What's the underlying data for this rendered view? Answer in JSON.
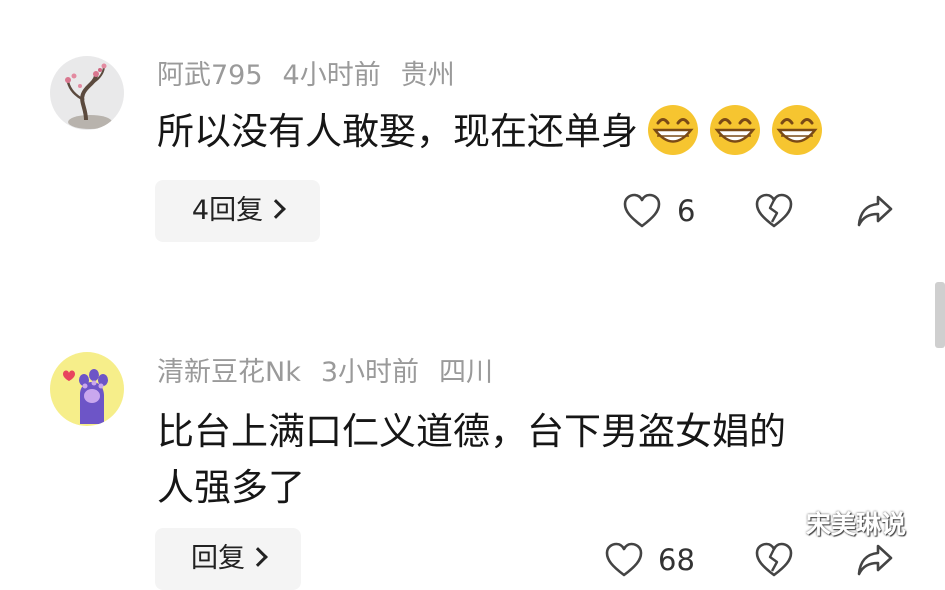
{
  "comments": [
    {
      "username": "阿武795",
      "time": "4小时前",
      "location": "贵州",
      "text": "所以没有人敢娶，现在还单身",
      "emoji_icon": "grinning-face-emoji",
      "emoji_count": 3,
      "reply_label": "4回复",
      "like_count": "6"
    },
    {
      "username": "清新豆花Nk",
      "time": "3小时前",
      "location": "四川",
      "text_line1": "比台上满口仁义道德，台下男盗女娼的",
      "text_line2": "人强多了",
      "reply_label": "回复",
      "like_count": "68"
    }
  ],
  "watermark": "宋美琳说",
  "colors": {
    "meta_text": "#9a9a9a",
    "body_text": "#161616",
    "reply_bg": "#f4f4f4",
    "icon_stroke": "#444444"
  }
}
